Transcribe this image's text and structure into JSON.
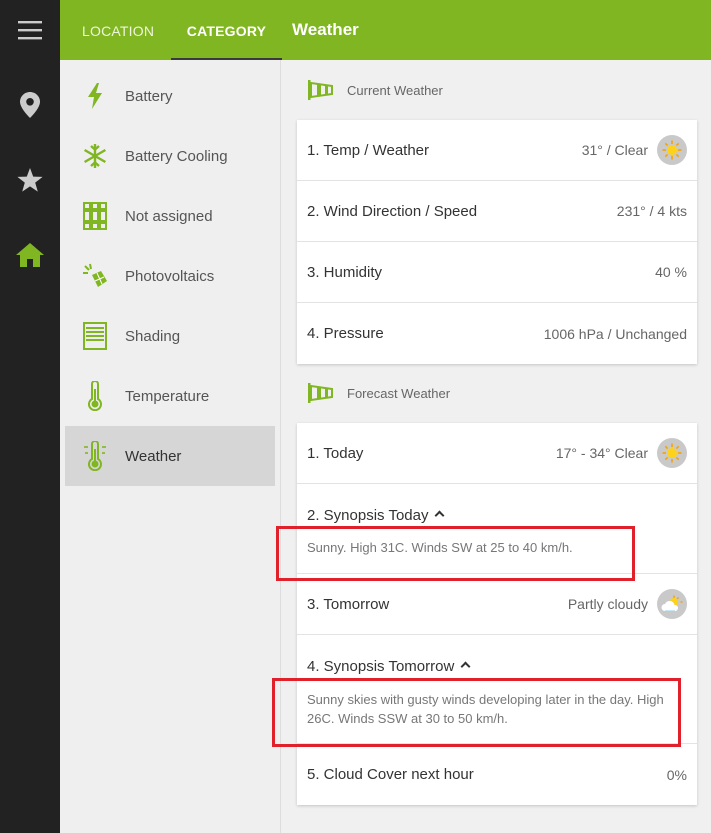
{
  "rail": {
    "items": [
      {
        "name": "menu-icon"
      },
      {
        "name": "location-pin-icon"
      },
      {
        "name": "star-icon"
      },
      {
        "name": "home-icon",
        "active": true
      }
    ]
  },
  "topbar": {
    "tabs": [
      {
        "label": "LOCATION",
        "active": false
      },
      {
        "label": "CATEGORY",
        "active": true
      }
    ],
    "title": "Weather"
  },
  "categories": [
    {
      "label": "Battery",
      "icon": "lightning-icon"
    },
    {
      "label": "Battery Cooling",
      "icon": "snowflake-icon"
    },
    {
      "label": "Not assigned",
      "icon": "not-assigned-icon"
    },
    {
      "label": "Photovoltaics",
      "icon": "photovoltaic-icon"
    },
    {
      "label": "Shading",
      "icon": "shading-icon"
    },
    {
      "label": "Temperature",
      "icon": "thermometer-icon"
    },
    {
      "label": "Weather",
      "icon": "weather-thermometer-icon",
      "selected": true
    }
  ],
  "current": {
    "heading": "Current Weather",
    "rows": [
      {
        "label": "1. Temp / Weather",
        "value": "31° / Clear",
        "icon": "sun-icon"
      },
      {
        "label": "2. Wind Direction / Speed",
        "value": "231° / 4 kts"
      },
      {
        "label": "3. Humidity",
        "value": "40 %"
      },
      {
        "label": "4. Pressure",
        "value": "1006 hPa / Unchanged"
      }
    ]
  },
  "forecast": {
    "heading": "Forecast Weather",
    "today": {
      "label": "1. Today",
      "value": "17° - 34° Clear",
      "icon": "sun-icon"
    },
    "synopsis_today": {
      "label": "2. Synopsis Today",
      "text": "Sunny. High 31C. Winds SW at 25 to 40 km/h."
    },
    "tomorrow": {
      "label": "3. Tomorrow",
      "value": "Partly cloudy",
      "icon": "partly-cloudy-icon"
    },
    "synopsis_tomorrow": {
      "label": "4. Synopsis Tomorrow",
      "text": "Sunny skies with gusty winds developing later in the day. High 26C. Winds SSW at 30 to 50 km/h."
    },
    "cloud_cover": {
      "label": "5. Cloud Cover next hour",
      "value": "0%"
    }
  },
  "colors": {
    "accent": "#80b622",
    "rail": "#222222",
    "highlight_box": "#e0202a"
  }
}
